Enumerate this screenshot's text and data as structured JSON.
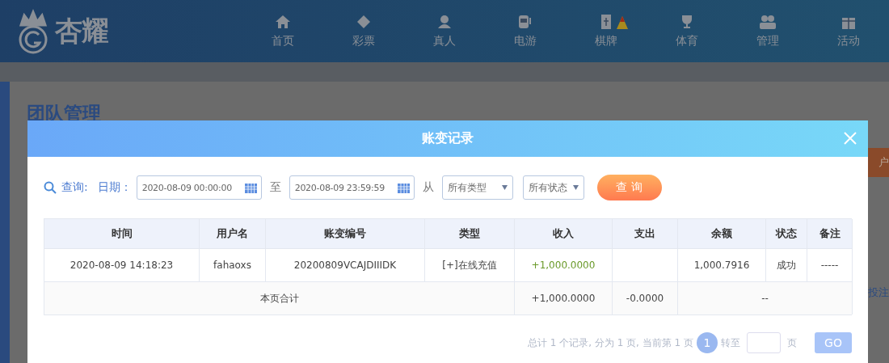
{
  "header": {
    "logo": "杏耀",
    "nav": [
      {
        "label": "首页",
        "badge": false
      },
      {
        "label": "彩票",
        "badge": false
      },
      {
        "label": "真人",
        "badge": false
      },
      {
        "label": "电游",
        "badge": false
      },
      {
        "label": "棋牌",
        "badge": true
      },
      {
        "label": "体育",
        "badge": false
      },
      {
        "label": "管理",
        "badge": false
      },
      {
        "label": "活动",
        "badge": false
      }
    ]
  },
  "page": {
    "title": "团队管理",
    "side_button": "户",
    "side_link": "投注"
  },
  "modal": {
    "title": "账变记录",
    "filters": {
      "query_label": "查询:",
      "date_label": "日期：",
      "start": "2020-08-09 00:00:00",
      "to": "至",
      "end": "2020-08-09 23:59:59",
      "from": "从",
      "type_select": "所有类型",
      "status_select": "所有状态",
      "button": "查 询"
    },
    "table": {
      "columns": [
        "时间",
        "用户名",
        "账变编号",
        "类型",
        "收入",
        "支出",
        "余额",
        "状态",
        "备注"
      ],
      "rows": [
        {
          "kind": "data",
          "cells": [
            "2020-08-09 14:18:23",
            "fahaoxs",
            "20200809VCAJDIIIDK",
            "[+]在线充值",
            "+1,000.0000",
            "",
            "1,000.7916",
            "成功",
            "-----"
          ]
        },
        {
          "kind": "total",
          "cells": [
            "本页合计",
            "",
            "",
            "",
            "+1,000.0000",
            "-0.0000",
            "--",
            "",
            ""
          ]
        }
      ]
    },
    "pagination": {
      "summary": "总计 1 个记录, 分为 1 页, 当前第 1 页",
      "pages": [
        {
          "label": "1",
          "selected": true
        }
      ],
      "goto": "转至",
      "unit": "页",
      "button": "GO"
    }
  }
}
